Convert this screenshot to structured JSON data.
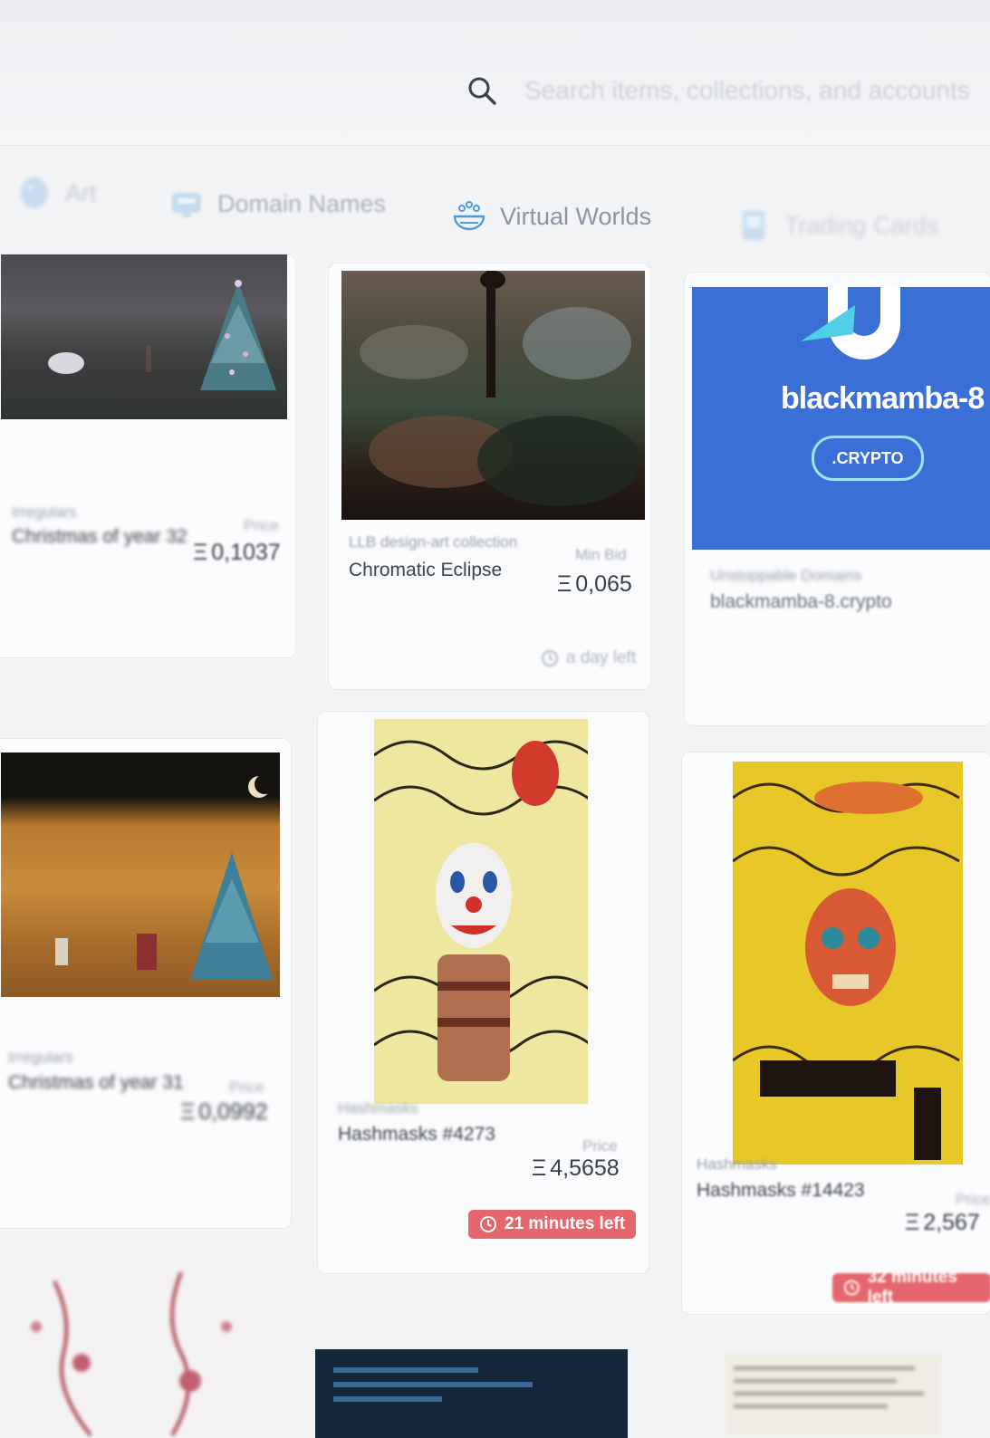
{
  "search": {
    "placeholder": "Search items, collections, and accounts"
  },
  "categories": [
    {
      "label": "Art",
      "icon": "art-icon"
    },
    {
      "label": "Domain Names",
      "icon": "domain-icon"
    },
    {
      "label": "Virtual Worlds",
      "icon": "virtual-worlds-icon"
    },
    {
      "label": "Trading Cards",
      "icon": "trading-cards-icon"
    }
  ],
  "cards": [
    {
      "collection": "Irregulars",
      "name": "Christmas of year 32",
      "price_label": "Price",
      "price": "0,1037",
      "timer": ""
    },
    {
      "collection": "LLB design-art collection",
      "name": "Chromatic Eclipse",
      "price_label": "Min Bid",
      "price": "0,065",
      "timer": "a day left"
    },
    {
      "collection": "Unstoppable Domains",
      "name": "blackmamba-8.crypto",
      "price_label": "",
      "price": "",
      "timer": "",
      "art_title": "blackmamba-8",
      "art_badge": ".CRYPTO"
    },
    {
      "collection": "Irregulars",
      "name": "Christmas of year 31",
      "price_label": "Price",
      "price": "0,0992",
      "timer": ""
    },
    {
      "collection": "Hashmasks",
      "name": "Hashmasks #4273",
      "price_label": "Price",
      "price": "4,5658",
      "timer": "21 minutes left"
    },
    {
      "collection": "Hashmasks",
      "name": "Hashmasks #14423",
      "price_label": "Price",
      "price": "2,567",
      "timer": "32 minutes left"
    }
  ],
  "currency_symbol": "Ξ",
  "colors": {
    "accent": "#2081e2",
    "timer_urgent": "#e5676d",
    "domain_card": "#3b6fd8"
  }
}
